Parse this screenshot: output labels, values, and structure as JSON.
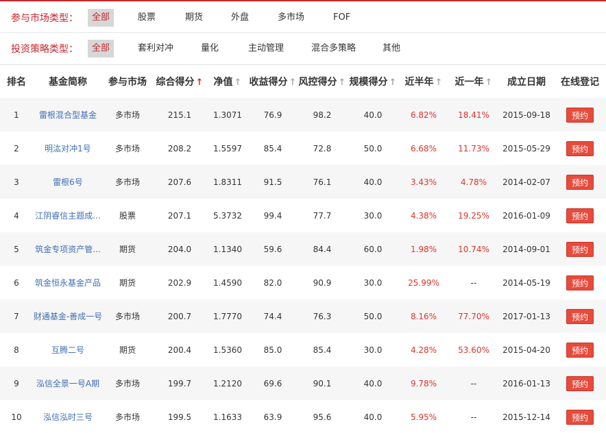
{
  "filters": {
    "market": {
      "label": "参与市场类型：",
      "options": [
        "全部",
        "股票",
        "期货",
        "外盘",
        "多市场",
        "FOF"
      ],
      "selected": "全部"
    },
    "strategy": {
      "label": "投资策略类型：",
      "options": [
        "全部",
        "套利对冲",
        "量化",
        "主动管理",
        "混合多策略",
        "其他"
      ],
      "selected": "全部"
    }
  },
  "table": {
    "headers": [
      "排名",
      "基金简称",
      "参与市场",
      "综合得分",
      "净值",
      "收益得分",
      "风控得分",
      "规模得分",
      "近半年",
      "近一年",
      "成立日期",
      "在线登记"
    ],
    "sort_icons": {
      "score": "up-arrow-icon",
      "nav": "up-arrow-icon",
      "return": "up-arrow-icon",
      "risk": "up-arrow-icon",
      "scale": "up-arrow-icon",
      "half": "up-arrow-icon",
      "year": "up-arrow-icon"
    },
    "arrow_glyph": "↑",
    "active_sort_color": "#e0232a",
    "button_label": "预约",
    "rows": [
      {
        "rank": "1",
        "name": "雷根混合型基金",
        "market": "多市场",
        "score": "215.1",
        "nav": "1.3071",
        "ret": "76.9",
        "risk": "98.2",
        "scale": "40.0",
        "half": "6.82%",
        "year": "18.41%",
        "date": "2015-09-18"
      },
      {
        "rank": "2",
        "name": "明汯对冲1号",
        "market": "多市场",
        "score": "208.2",
        "nav": "1.5597",
        "ret": "85.4",
        "risk": "72.8",
        "scale": "50.0",
        "half": "6.68%",
        "year": "11.73%",
        "date": "2015-05-29"
      },
      {
        "rank": "3",
        "name": "雷根6号",
        "market": "多市场",
        "score": "207.6",
        "nav": "1.8311",
        "ret": "91.5",
        "risk": "76.1",
        "scale": "40.0",
        "half": "3.43%",
        "year": "4.78%",
        "date": "2014-02-07"
      },
      {
        "rank": "4",
        "name": "江阴睿信主题成...",
        "market": "股票",
        "score": "207.1",
        "nav": "5.3732",
        "ret": "99.4",
        "risk": "77.7",
        "scale": "30.0",
        "half": "4.38%",
        "year": "19.25%",
        "date": "2016-01-09"
      },
      {
        "rank": "5",
        "name": "筑金专项资产管...",
        "market": "期货",
        "score": "204.0",
        "nav": "1.1340",
        "ret": "59.6",
        "risk": "84.4",
        "scale": "60.0",
        "half": "1.98%",
        "year": "10.74%",
        "date": "2014-09-01"
      },
      {
        "rank": "6",
        "name": "筑金恒永基金产品",
        "market": "期货",
        "score": "202.9",
        "nav": "1.4590",
        "ret": "82.0",
        "risk": "90.9",
        "scale": "30.0",
        "half": "25.99%",
        "year": "--",
        "date": "2014-05-19"
      },
      {
        "rank": "7",
        "name": "财通基金-善成一号",
        "market": "多市场",
        "score": "200.7",
        "nav": "1.7770",
        "ret": "74.4",
        "risk": "76.3",
        "scale": "50.0",
        "half": "8.16%",
        "year": "77.70%",
        "date": "2017-01-13"
      },
      {
        "rank": "8",
        "name": "互腾二号",
        "market": "期货",
        "score": "200.4",
        "nav": "1.5360",
        "ret": "85.0",
        "risk": "85.4",
        "scale": "30.0",
        "half": "4.28%",
        "year": "53.60%",
        "date": "2015-04-20"
      },
      {
        "rank": "9",
        "name": "泓信全景一号A期",
        "market": "多市场",
        "score": "199.7",
        "nav": "1.2120",
        "ret": "69.6",
        "risk": "90.1",
        "scale": "40.0",
        "half": "9.78%",
        "year": "--",
        "date": "2016-01-13"
      },
      {
        "rank": "10",
        "name": "泓信泓时三号",
        "market": "多市场",
        "score": "199.5",
        "nav": "1.1633",
        "ret": "63.9",
        "risk": "95.6",
        "scale": "40.0",
        "half": "5.95%",
        "year": "--",
        "date": "2015-12-14"
      }
    ]
  }
}
